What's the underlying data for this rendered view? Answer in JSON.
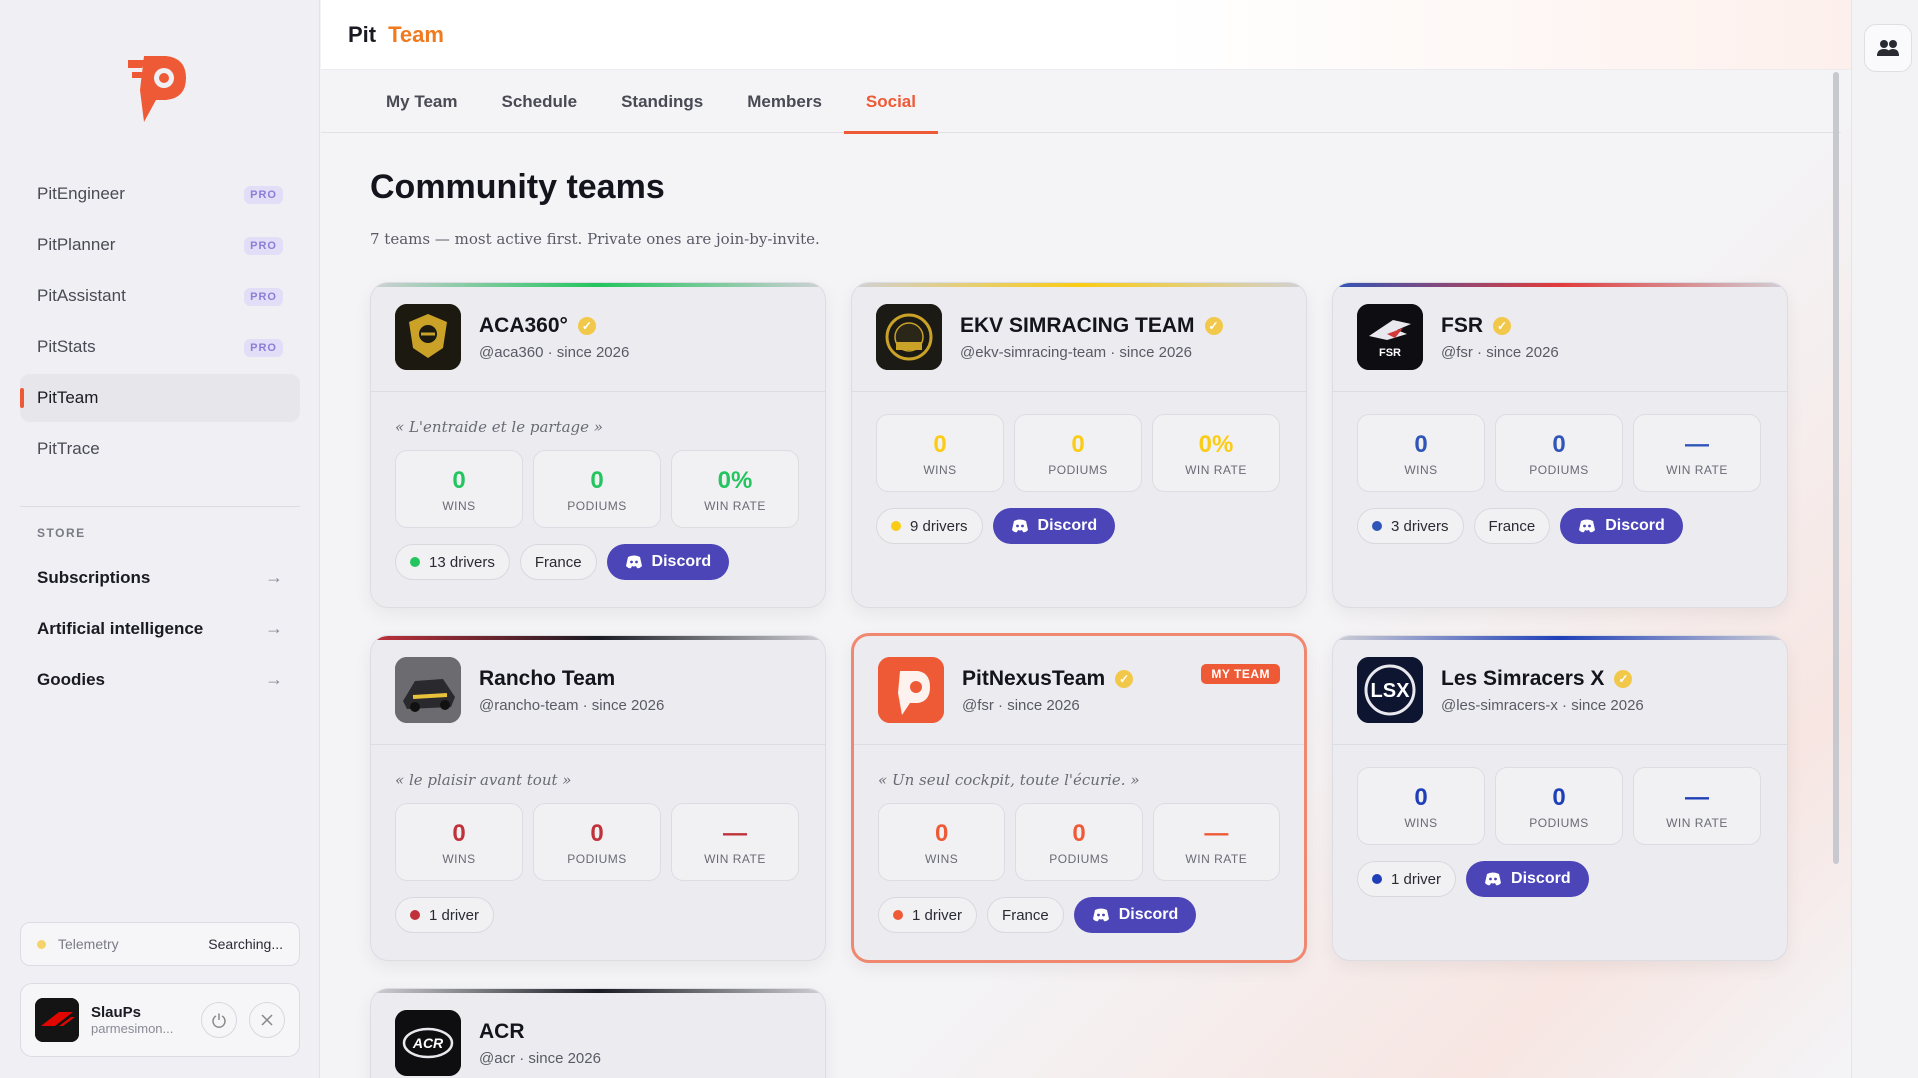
{
  "app": {
    "brand_1": "Pit",
    "brand_2": "Team"
  },
  "sidebar": {
    "nav": [
      {
        "label": "PitEngineer",
        "badge": "PRO"
      },
      {
        "label": "PitPlanner",
        "badge": "PRO"
      },
      {
        "label": "PitAssistant",
        "badge": "PRO"
      },
      {
        "label": "PitStats",
        "badge": "PRO"
      },
      {
        "label": "PitTeam",
        "badge": ""
      },
      {
        "label": "PitTrace",
        "badge": ""
      }
    ],
    "store_label": "STORE",
    "store": [
      {
        "label": "Subscriptions",
        "arrow": "→"
      },
      {
        "label": "Artificial intelligence",
        "arrow": "→"
      },
      {
        "label": "Goodies",
        "arrow": "→"
      }
    ],
    "telemetry": {
      "label": "Telemetry",
      "status": "Searching..."
    },
    "user": {
      "name": "SlauPs",
      "email": "parmesimon..."
    }
  },
  "tabs": [
    "My Team",
    "Schedule",
    "Standings",
    "Members",
    "Social"
  ],
  "active_tab": "Social",
  "page": {
    "title": "Community teams",
    "subtitle": "7 teams — most active first. Private ones are join-by-invite."
  },
  "teams": [
    {
      "name": "ACA360°",
      "verified": true,
      "handle": "@aca360 · since 2026",
      "motto": "« L'entraide et le partage »",
      "wins": "0",
      "podiums": "0",
      "win_rate": "0%",
      "drivers": "13 drivers",
      "country": "France",
      "discord": "Discord",
      "accent": "#22c55e"
    },
    {
      "name": "EKV SIMRACING TEAM",
      "verified": true,
      "handle": "@ekv-simracing-team · since 2026",
      "motto": "",
      "wins": "0",
      "podiums": "0",
      "win_rate": "0%",
      "drivers": "9 drivers",
      "country": "",
      "discord": "Discord",
      "accent": "#facc15"
    },
    {
      "name": "FSR",
      "verified": true,
      "handle": "@fsr · since 2026",
      "motto": "",
      "wins": "0",
      "podiums": "0",
      "win_rate": "—",
      "drivers": "3 drivers",
      "country": "France",
      "discord": "Discord",
      "accent": "#2f55b8"
    },
    {
      "name": "Rancho Team",
      "verified": false,
      "handle": "@rancho-team · since 2026",
      "motto": "« le plaisir avant tout »",
      "wins": "0",
      "podiums": "0",
      "win_rate": "—",
      "drivers": "1 driver",
      "country": "",
      "discord": "",
      "accent": "#c0313a"
    },
    {
      "name": "PitNexusTeam",
      "verified": true,
      "handle": "@fsr · since 2026",
      "motto": "« Un seul cockpit, toute l'écurie. »",
      "wins": "0",
      "podiums": "0",
      "win_rate": "—",
      "drivers": "1 driver",
      "country": "France",
      "discord": "Discord",
      "accent": "#ef5a36",
      "badge": "MY TEAM"
    },
    {
      "name": "Les Simracers X",
      "verified": true,
      "handle": "@les-simracers-x · since 2026",
      "motto": "",
      "wins": "0",
      "podiums": "0",
      "win_rate": "—",
      "drivers": "1 driver",
      "country": "",
      "discord": "Discord",
      "accent": "#1f3fb8"
    },
    {
      "name": "ACR",
      "verified": false,
      "handle": "@acr · since 2026"
    }
  ],
  "labels": {
    "wins": "WINS",
    "podiums": "PODIUMS",
    "win_rate": "WIN RATE"
  },
  "colors": {
    "accent": "#ef5a36",
    "discord": "#4b45b8",
    "brand_orange": "#f07a1f"
  }
}
